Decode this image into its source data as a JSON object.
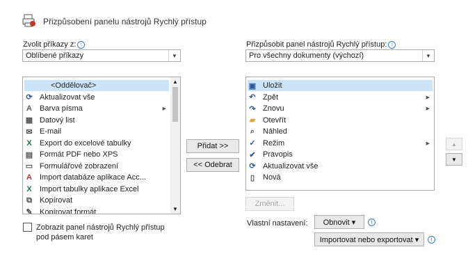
{
  "title": "Přizpůsobení panelu nástrojů Rychlý přístup",
  "left": {
    "label": "Zvolit příkazy z:",
    "dropdown_value": "Oblíbené příkazy",
    "items": [
      {
        "label": "<Oddělovač>",
        "icon": "separator-icon"
      },
      {
        "label": "Aktualizovat vše",
        "icon": "refresh-all-icon"
      },
      {
        "label": "Barva písma",
        "icon": "font-color-icon"
      },
      {
        "label": "Datový list",
        "icon": "datasheet-icon"
      },
      {
        "label": "E-mail",
        "icon": "email-icon"
      },
      {
        "label": "Export do excelové tabulky",
        "icon": "excel-export-icon"
      },
      {
        "label": "Formát PDF nebo XPS",
        "icon": "pdf-xps-icon"
      },
      {
        "label": "Formulářové zobrazení",
        "icon": "form-view-icon"
      },
      {
        "label": "Import databáze aplikace Acc...",
        "icon": "access-import-icon"
      },
      {
        "label": "Import tabulky aplikace Excel",
        "icon": "excel-import-icon"
      },
      {
        "label": "Kopírovat",
        "icon": "copy-icon"
      },
      {
        "label": "Kopírovat formát",
        "icon": "format-painter-icon"
      }
    ],
    "checkbox_label_1": "Zobrazit panel nástrojů Rychlý přístup",
    "checkbox_label_2": "pod pásem karet"
  },
  "middle": {
    "add_label": "Přidat >>",
    "remove_label": "<< Odebrat"
  },
  "right": {
    "label": "Přizpůsobit panel nástrojů Rychlý přístup:",
    "dropdown_value": "Pro všechny dokumenty (výchozí)",
    "items": [
      {
        "label": "Uložit",
        "icon": "save-icon"
      },
      {
        "label": "Zpět",
        "icon": "undo-icon"
      },
      {
        "label": "Znovu",
        "icon": "redo-icon"
      },
      {
        "label": "Otevřít",
        "icon": "open-folder-icon"
      },
      {
        "label": "Náhled",
        "icon": "print-preview-icon"
      },
      {
        "label": "Režim",
        "icon": "mode-icon"
      },
      {
        "label": "Pravopis",
        "icon": "spelling-icon"
      },
      {
        "label": "Aktualizovat vše",
        "icon": "refresh-all-icon"
      },
      {
        "label": "Nová",
        "icon": "new-document-icon"
      }
    ],
    "modify_label": "Změnit...",
    "custom_label": "Vlastní nastavení:",
    "reset_label": "Obnovit ▾",
    "import_export_label": "Importovat nebo exportovat ▾"
  },
  "colors": {
    "accent": "#2b579a",
    "selection": "#cce4f7",
    "info": "#3a7bd5"
  }
}
